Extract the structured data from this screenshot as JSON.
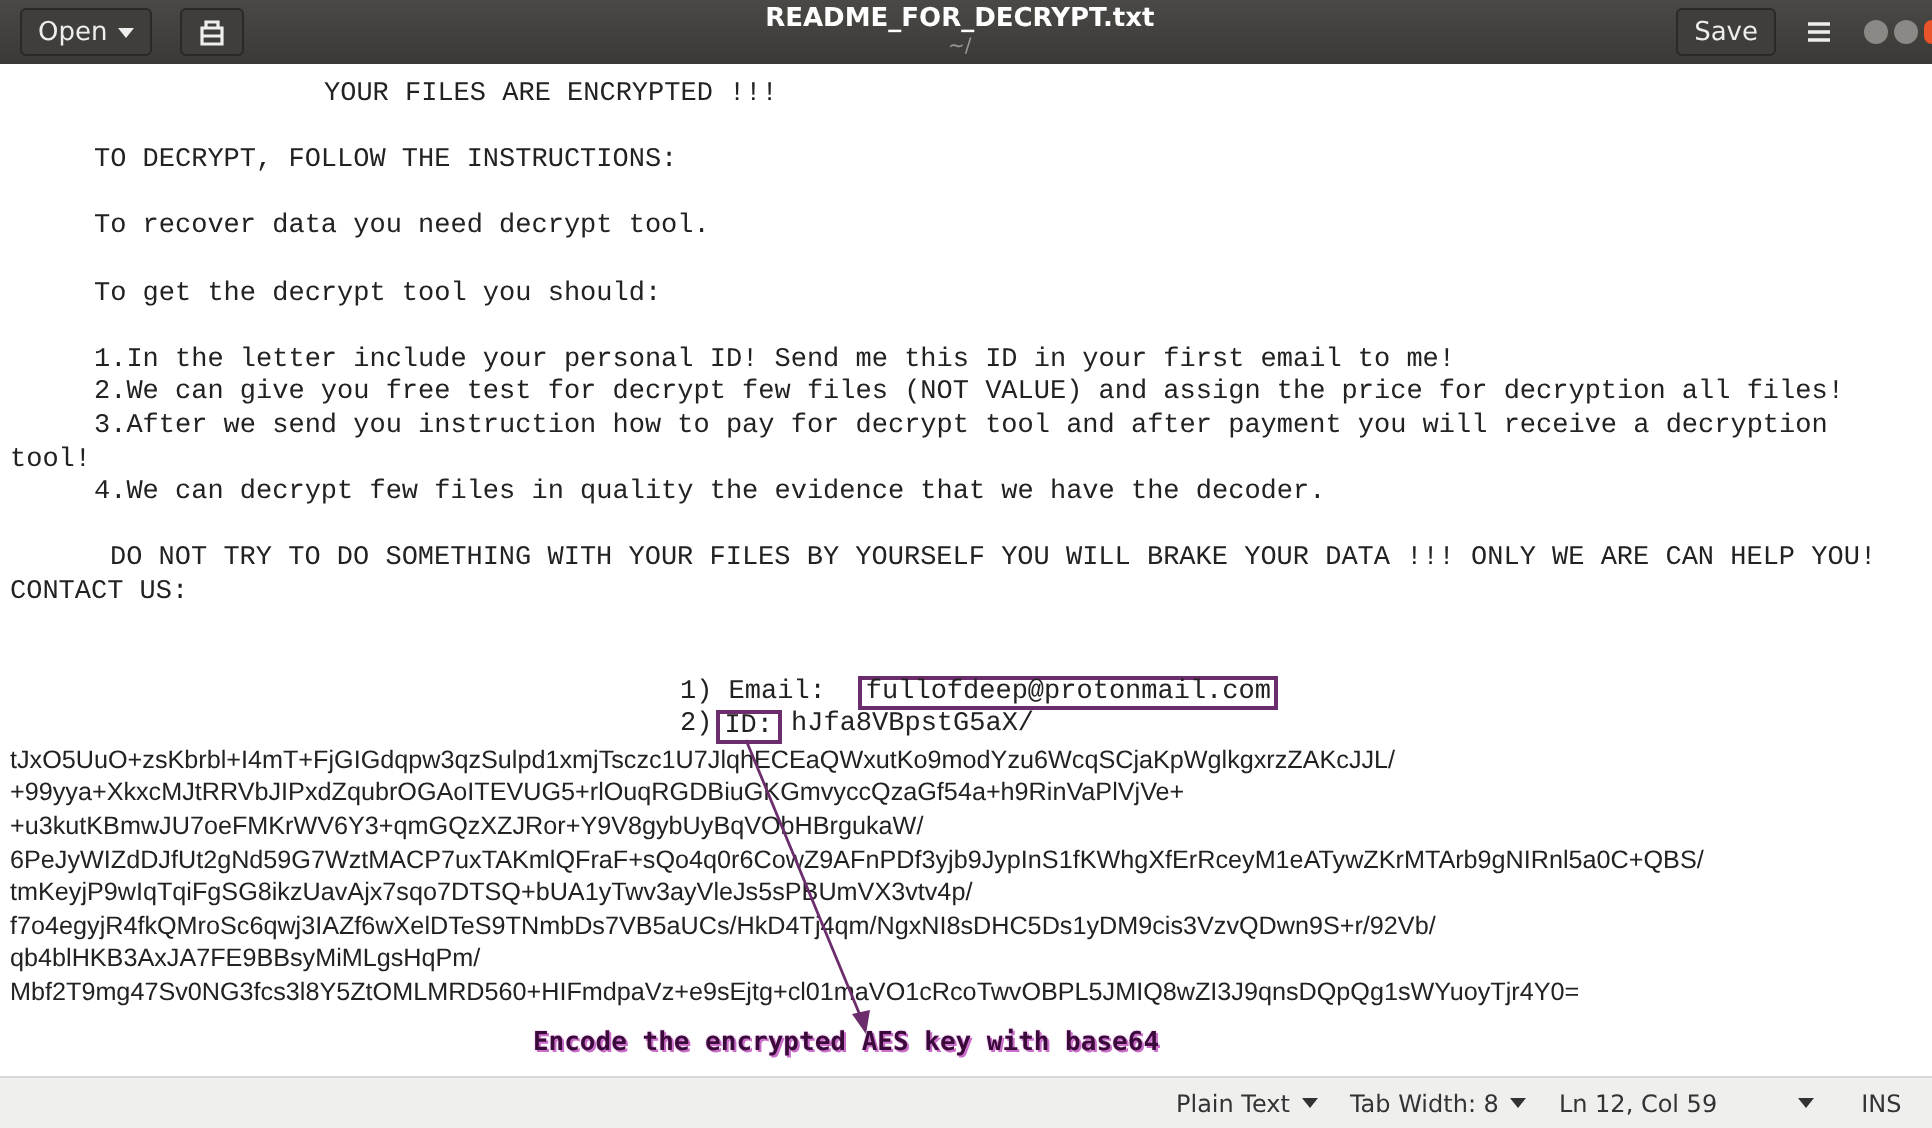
{
  "window": {
    "title": "README_FOR_DECRYPT.txt",
    "subtitle": "~/",
    "open_button": "Open",
    "save_button": "Save"
  },
  "lines": [
    {
      "kind": "title",
      "text": "YOUR FILES ARE ENCRYPTED !!!"
    },
    {
      "kind": "blank"
    },
    {
      "kind": "indented",
      "text": "TO DECRYPT, FOLLOW THE INSTRUCTIONS:"
    },
    {
      "kind": "blank"
    },
    {
      "kind": "indented",
      "text": "To recover data you need decrypt tool."
    },
    {
      "kind": "blank"
    },
    {
      "kind": "indented",
      "text": "To get the decrypt tool you should:"
    },
    {
      "kind": "blank"
    },
    {
      "kind": "indented",
      "text": "1.In the letter include your personal ID! Send me this ID in your first email to me!"
    },
    {
      "kind": "indented",
      "text": "2.We can give you free test for decrypt few files (NOT VALUE) and assign the price for decryption all files!"
    },
    {
      "kind": "indented",
      "text": "3.After we send you instruction how to pay for decrypt tool and after payment you will receive a decryption"
    },
    {
      "kind": "flush",
      "text": "tool!"
    },
    {
      "kind": "indented",
      "text": "4.We can decrypt few files in quality the evidence that we have the decoder."
    },
    {
      "kind": "blank"
    },
    {
      "kind": "notice",
      "text": "DO NOT TRY TO DO SOMETHING WITH YOUR FILES BY YOURSELF YOU WILL BRAKE YOUR DATA !!! ONLY WE ARE CAN HELP YOU!"
    },
    {
      "kind": "flush",
      "text": "CONTACT US:"
    },
    {
      "kind": "blank"
    },
    {
      "kind": "blank"
    },
    {
      "kind": "email",
      "number": "1) Email:",
      "value": "fullofdeep@protonmail.com"
    },
    {
      "kind": "id",
      "number": "2)",
      "label": "ID:",
      "value": "hJfa8VBpstG5aX/"
    },
    {
      "kind": "code",
      "text": "tJxO5UuO+zsKbrbl+I4mT+FjGIGdqpw3qzSulpd1xmjTsczc1U7JlqhECEaQWxutKo9modYzu6WcqSCjaKpWglkgxrzZAKcJJL/"
    },
    {
      "kind": "code",
      "text": "+99yya+XkxcMJtRRVbJIPxdZqubrOGAoITEVUG5+rlOuqRGDBiuGKGmvyccQzaGf54a+h9RinVaPlVjVe+"
    },
    {
      "kind": "code",
      "text": "+u3kutKBmwJU7oeFMKrWV6Y3+qmGQzXZJRor+Y9V8gybUyBqVObHBrgukaW/"
    },
    {
      "kind": "code",
      "text": "6PeJyWIZdDJfUt2gNd59G7WztMACP7uxTAKmlQFraF+sQo4q0r6CowZ9AFnPDf3yjb9JypInS1fKWhgXfErRceyM1eATywZKrMTArb9gNIRnl5a0C+QBS/"
    },
    {
      "kind": "code",
      "text": "tmKeyjP9wIqTqiFgSG8ikzUavAjx7sqo7DTSQ+bUA1yTwv3ayVleJs5sPBUmVX3vtv4p/"
    },
    {
      "kind": "code",
      "text": "f7o4egyjR4fkQMroSc6qwj3IAZf6wXelDTeS9TNmbDs7VB5aUCs/HkD4Tj4qm/NgxNI8sDHC5Ds1yDM9cis3VzvQDwn9S+r/92Vb/"
    },
    {
      "kind": "code",
      "text": "qb4blHKB3AxJA7FE9BBsyMiMLgsHqPm/"
    },
    {
      "kind": "code",
      "text": "Mbf2T9mg47Sv0NG3fcs3l8Y5ZtOMLMRD560+HIFmdpaVz+e9sEjtg+cl01maVO1cRcoTwvOBPL5JMIQ8wZI3J9qnsDQpQg1sWYuoyTjr4Y0="
    }
  ],
  "annotation": {
    "text": "Encode the encrypted AES key with base64"
  },
  "status_bar": [
    {
      "kind": "menu",
      "label": "Plain Text"
    },
    {
      "kind": "menu",
      "label": "Tab Width: 8"
    },
    {
      "kind": "text",
      "label": "Ln 12, Col 59"
    },
    {
      "kind": "caret"
    },
    {
      "kind": "text",
      "label": "INS"
    }
  ]
}
